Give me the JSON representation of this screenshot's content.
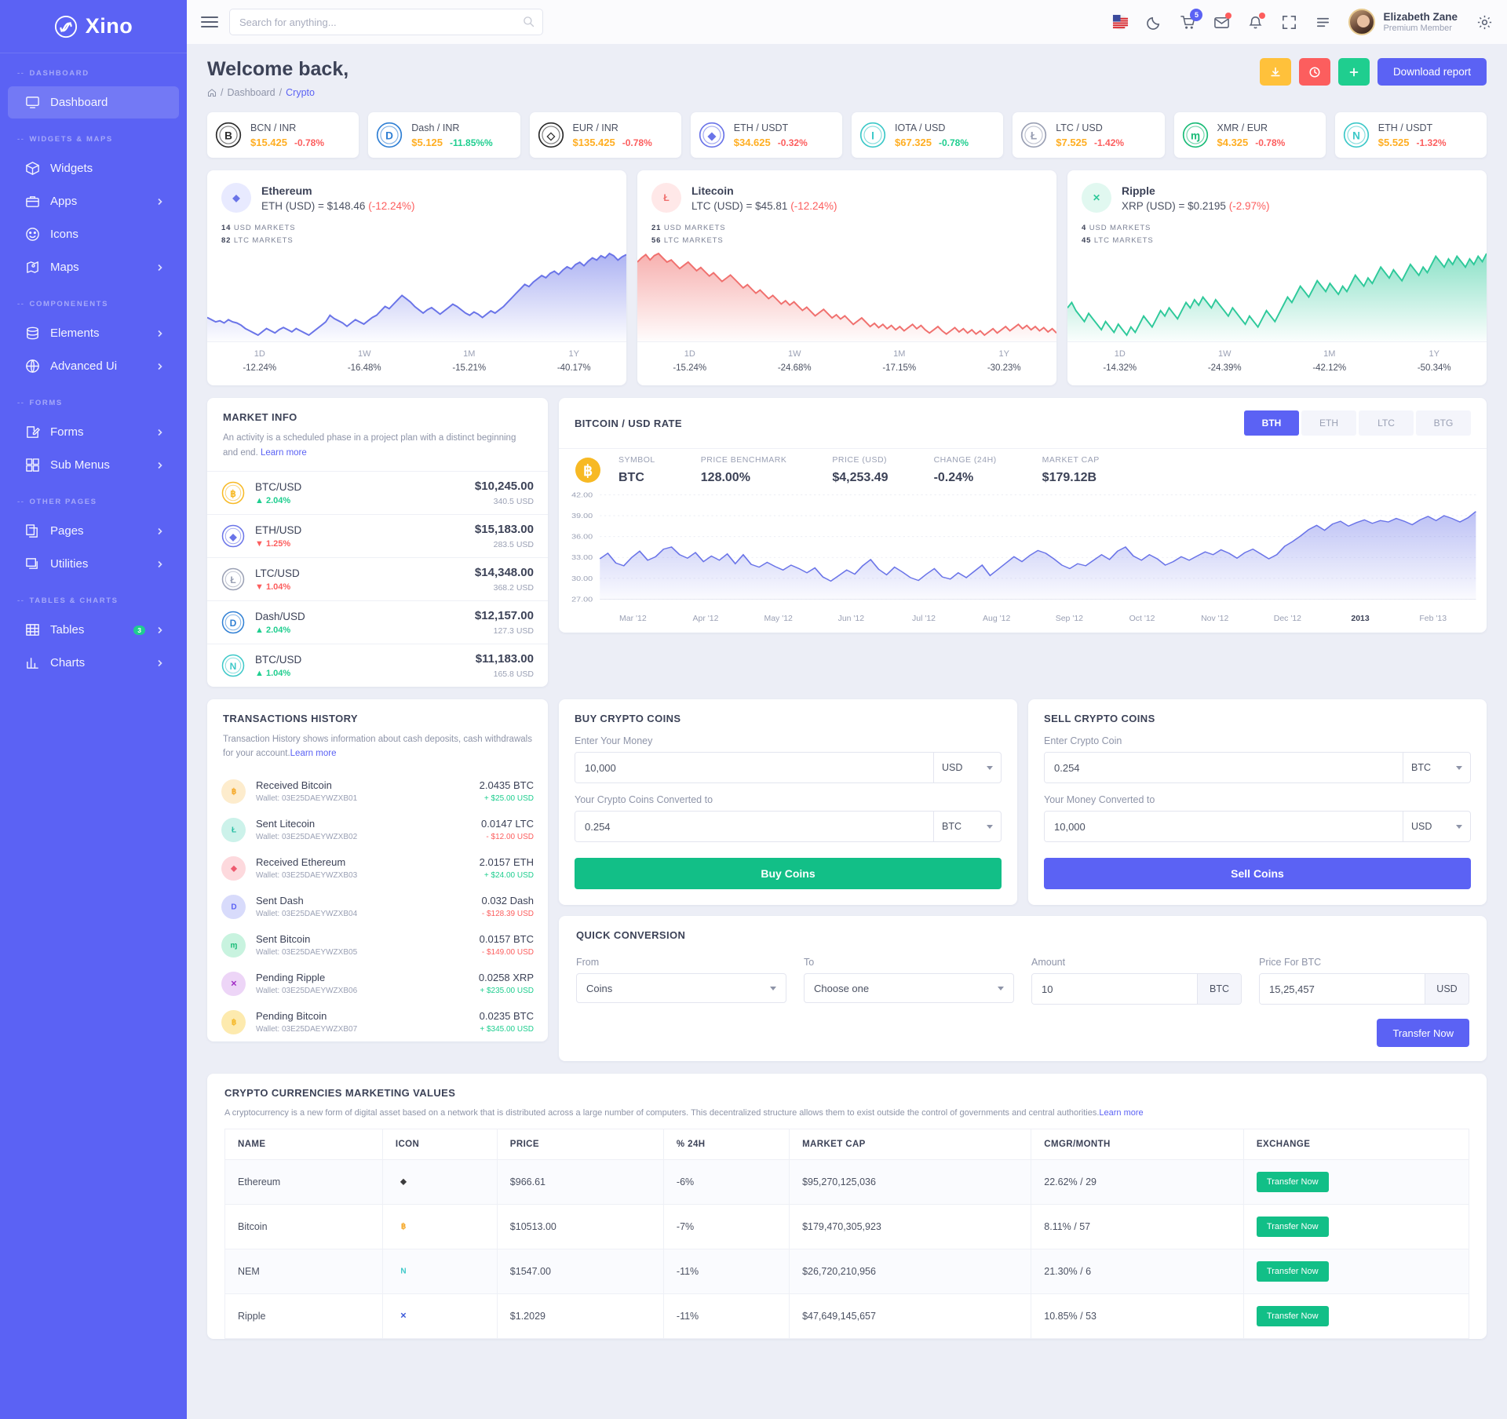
{
  "brand": {
    "name": "Xino",
    "logo_icon": "spiral-logo-icon"
  },
  "sidebar": {
    "sections": [
      {
        "label": "DASHBOARD",
        "items": [
          {
            "label": "Dashboard",
            "icon": "monitor-icon",
            "active": true,
            "chevron": false
          }
        ]
      },
      {
        "label": "WIDGETS & MAPS",
        "items": [
          {
            "label": "Widgets",
            "icon": "box-icon",
            "chevron": false
          },
          {
            "label": "Apps",
            "icon": "briefcase-icon",
            "chevron": true
          },
          {
            "label": "Icons",
            "icon": "smiley-icon",
            "chevron": false
          },
          {
            "label": "Maps",
            "icon": "map-pin-icon",
            "chevron": true
          }
        ]
      },
      {
        "label": "COMPONENENTS",
        "items": [
          {
            "label": "Elements",
            "icon": "database-icon",
            "chevron": true
          },
          {
            "label": "Advanced Ui",
            "icon": "globe-icon",
            "chevron": true
          }
        ]
      },
      {
        "label": "FORMS",
        "items": [
          {
            "label": "Forms",
            "icon": "edit-square-icon",
            "chevron": true
          },
          {
            "label": "Sub Menus",
            "icon": "grid-icon",
            "chevron": true
          }
        ]
      },
      {
        "label": "OTHER PAGES",
        "items": [
          {
            "label": "Pages",
            "icon": "copy-pages-icon",
            "chevron": true
          },
          {
            "label": "Utilities",
            "icon": "layers-icon",
            "chevron": true
          }
        ]
      },
      {
        "label": "TABLES & CHARTS",
        "items": [
          {
            "label": "Tables",
            "icon": "table-grid-icon",
            "chevron": true,
            "badge": "3"
          },
          {
            "label": "Charts",
            "icon": "bar-chart-icon",
            "chevron": true
          }
        ]
      }
    ]
  },
  "topbar": {
    "menu_icon": "hamburger-icon",
    "search_placeholder": "Search for anything...",
    "search_value": "",
    "icons": [
      {
        "name": "flag-us-icon"
      },
      {
        "name": "moon-icon"
      },
      {
        "name": "cart-icon",
        "badge": "5"
      },
      {
        "name": "mail-icon",
        "dot": true
      },
      {
        "name": "bell-icon",
        "dot": true
      },
      {
        "name": "fullscreen-icon"
      },
      {
        "name": "list-toggle-icon"
      }
    ],
    "user": {
      "name": "Elizabeth Zane",
      "role": "Premium Member"
    },
    "settings_icon": "gear-icon"
  },
  "header": {
    "title": "Welcome back,",
    "breadcrumb": {
      "home_icon": "home-icon",
      "sep": "/",
      "parent": "Dashboard",
      "current": "Crypto"
    },
    "buttons": {
      "download_icon": "download-icon",
      "clock_icon": "clock-icon",
      "plus_icon": "plus-icon",
      "report_label": "Download report"
    }
  },
  "tickers": [
    {
      "icon": "bytecoin-icon",
      "pair": "BCN / INR",
      "price": "$15.425",
      "change": "-0.78%",
      "dir": "down"
    },
    {
      "icon": "dash-icon",
      "pair": "Dash / INR",
      "price": "$5.125",
      "change": "-11.85%%",
      "dir": "up"
    },
    {
      "icon": "eos-icon",
      "pair": "EUR / INR",
      "price": "$135.425",
      "change": "-0.78%",
      "dir": "down"
    },
    {
      "icon": "ethereum-icon",
      "pair": "ETH / USDT",
      "price": "$34.625",
      "change": "-0.32%",
      "dir": "down"
    },
    {
      "icon": "iota-icon",
      "pair": "IOTA / USD",
      "price": "$67.325",
      "change": "-0.78%",
      "dir": "up"
    },
    {
      "icon": "litecoin-icon",
      "pair": "LTC / USD",
      "price": "$7.525",
      "change": "-1.42%",
      "dir": "down"
    },
    {
      "icon": "monero-icon",
      "pair": "XMR / EUR",
      "price": "$4.325",
      "change": "-0.78%",
      "dir": "down"
    },
    {
      "icon": "nem-icon",
      "pair": "ETH / USDT",
      "price": "$5.525",
      "change": "-1.32%",
      "dir": "down"
    }
  ],
  "coin_cards": [
    {
      "name": "Ethereum",
      "icon": "ethereum-icon",
      "accent": "#6a74e8",
      "badge_bg": "#e8eaff",
      "rate_prefix": "ETH (USD) = $148.46",
      "rate_change": "(-12.24%)",
      "markets": [
        {
          "n": "14",
          "t": "USD MARKETS"
        },
        {
          "n": "82",
          "t": "LTC MARKETS"
        }
      ],
      "periods": [
        {
          "k": "1D",
          "v": "-12.24%"
        },
        {
          "k": "1W",
          "v": "-16.48%"
        },
        {
          "k": "1M",
          "v": "-15.21%"
        },
        {
          "k": "1Y",
          "v": "-40.17%"
        }
      ],
      "chart_data": {
        "type": "area",
        "series_name": "Ethereum price",
        "values": [
          38,
          36,
          34,
          35,
          33,
          36,
          34,
          33,
          31,
          28,
          26,
          24,
          22,
          25,
          28,
          26,
          24,
          27,
          29,
          27,
          25,
          28,
          26,
          24,
          22,
          25,
          28,
          31,
          34,
          40,
          37,
          35,
          33,
          30,
          33,
          36,
          34,
          32,
          35,
          38,
          40,
          44,
          48,
          46,
          50,
          54,
          58,
          55,
          52,
          48,
          45,
          42,
          45,
          47,
          44,
          41,
          44,
          47,
          50,
          48,
          45,
          42,
          40,
          43,
          41,
          38,
          41,
          44,
          42,
          45,
          48,
          52,
          56,
          60,
          64,
          68,
          66,
          70,
          73,
          76,
          74,
          78,
          80,
          77,
          81,
          84,
          82,
          86,
          88,
          85,
          89,
          92,
          90,
          94,
          92,
          96,
          94,
          90,
          93,
          95
        ]
      }
    },
    {
      "name": "Litecoin",
      "icon": "litecoin-icon",
      "accent": "#f0706e",
      "badge_bg": "#ffe8e8",
      "rate_prefix": "LTC (USD) = $45.81",
      "rate_change": "(-12.24%)",
      "markets": [
        {
          "n": "21",
          "t": "USD MARKETS"
        },
        {
          "n": "56",
          "t": "LTC MARKETS"
        }
      ],
      "periods": [
        {
          "k": "1D",
          "v": "-15.24%"
        },
        {
          "k": "1W",
          "v": "-24.68%"
        },
        {
          "k": "1M",
          "v": "-17.15%"
        },
        {
          "k": "1Y",
          "v": "-30.23%"
        }
      ],
      "chart_data": {
        "type": "area",
        "series_name": "Litecoin price",
        "values": [
          88,
          92,
          95,
          90,
          94,
          96,
          92,
          88,
          90,
          86,
          82,
          85,
          88,
          84,
          80,
          83,
          79,
          75,
          78,
          74,
          70,
          73,
          76,
          72,
          68,
          64,
          67,
          63,
          59,
          62,
          58,
          54,
          57,
          53,
          49,
          52,
          48,
          51,
          47,
          43,
          46,
          42,
          38,
          41,
          44,
          40,
          36,
          39,
          35,
          38,
          34,
          30,
          33,
          36,
          32,
          28,
          31,
          27,
          30,
          26,
          29,
          25,
          28,
          24,
          27,
          30,
          26,
          29,
          25,
          22,
          25,
          28,
          24,
          21,
          24,
          27,
          23,
          26,
          22,
          25,
          21,
          24,
          20,
          23,
          26,
          22,
          25,
          28,
          24,
          27,
          30,
          26,
          29,
          25,
          28,
          24,
          27,
          23,
          26,
          22
        ]
      }
    },
    {
      "name": "Ripple",
      "icon": "ripple-icon",
      "accent": "#2ec99a",
      "badge_bg": "#e1f8f0",
      "rate_prefix": "XRP (USD) = $0.2195",
      "rate_change": "(-2.97%)",
      "markets": [
        {
          "n": "4",
          "t": "USD MARKETS"
        },
        {
          "n": "45",
          "t": "LTC MARKETS"
        }
      ],
      "periods": [
        {
          "k": "1D",
          "v": "-14.32%"
        },
        {
          "k": "1W",
          "v": "-24.39%"
        },
        {
          "k": "1M",
          "v": "-42.12%"
        },
        {
          "k": "1Y",
          "v": "-50.34%"
        }
      ],
      "chart_data": {
        "type": "area",
        "series_name": "Ripple price",
        "values": [
          54,
          58,
          52,
          48,
          44,
          50,
          46,
          42,
          38,
          44,
          40,
          36,
          42,
          38,
          34,
          40,
          36,
          42,
          48,
          44,
          40,
          46,
          52,
          48,
          54,
          50,
          46,
          52,
          58,
          54,
          60,
          56,
          62,
          58,
          54,
          60,
          56,
          52,
          48,
          54,
          50,
          46,
          42,
          48,
          44,
          40,
          46,
          52,
          48,
          44,
          50,
          56,
          62,
          58,
          64,
          70,
          66,
          62,
          68,
          74,
          70,
          66,
          72,
          68,
          64,
          70,
          66,
          72,
          78,
          74,
          70,
          76,
          72,
          78,
          84,
          80,
          76,
          82,
          78,
          74,
          80,
          86,
          82,
          78,
          84,
          80,
          86,
          92,
          88,
          84,
          90,
          86,
          92,
          88,
          84,
          90,
          86,
          92,
          88,
          94
        ]
      }
    }
  ],
  "market_info": {
    "title": "MARKET INFO",
    "desc": "An activity is a scheduled phase in a project plan with a distinct beginning and end.",
    "link": "Learn more",
    "rows": [
      {
        "icon": "bitcoin-icon",
        "pair": "BTC/USD",
        "change": "2.04%",
        "dir": "up",
        "price": "$10,245.00",
        "vol": "340.5 USD"
      },
      {
        "icon": "ethereum-icon",
        "pair": "ETH/USD",
        "change": "1.25%",
        "dir": "down",
        "price": "$15,183.00",
        "vol": "283.5 USD"
      },
      {
        "icon": "litecoin-icon",
        "pair": "LTC/USD",
        "change": "1.04%",
        "dir": "down",
        "price": "$14,348.00",
        "vol": "368.2 USD"
      },
      {
        "icon": "dash-icon",
        "pair": "Dash/USD",
        "change": "2.04%",
        "dir": "up",
        "price": "$12,157.00",
        "vol": "127.3 USD"
      },
      {
        "icon": "nem-icon",
        "pair": "BTC/USD",
        "change": "1.04%",
        "dir": "up",
        "price": "$11,183.00",
        "vol": "165.8 USD"
      }
    ]
  },
  "rate_panel": {
    "title": "BITCOIN / USD RATE",
    "tabs": [
      {
        "label": "BTH",
        "active": true
      },
      {
        "label": "ETH",
        "active": false
      },
      {
        "label": "LTC",
        "active": false
      },
      {
        "label": "BTG",
        "active": false
      }
    ],
    "coin_icon": "bitcoin-icon",
    "stats": [
      {
        "k": "SYMBOL",
        "v": "BTC"
      },
      {
        "k": "PRICE BENCHMARK",
        "v": "128.00%"
      },
      {
        "k": "PRICE (USD)",
        "v": "$4,253.49"
      },
      {
        "k": "CHANGE (24H)",
        "v": "-0.24%"
      },
      {
        "k": "MARKET CAP",
        "v": "$179.12B"
      }
    ],
    "chart_data": {
      "type": "area",
      "title": "BITCOIN / USD RATE",
      "ylabel": "",
      "xlabel": "",
      "ylim": [
        27.0,
        42.0
      ],
      "yticks": [
        "27.00",
        "30.00",
        "33.00",
        "36.00",
        "39.00",
        "42.00"
      ],
      "grid": true,
      "x": [
        "Mar '12",
        "Apr '12",
        "May '12",
        "Jun '12",
        "Jul '12",
        "Aug '12",
        "Sep '12",
        "Oct '12",
        "Nov '12",
        "Dec '12",
        "2013",
        "Feb '13"
      ],
      "x_bold": "2013",
      "series": [
        {
          "name": "BTC/USD",
          "values": [
            32.8,
            33.6,
            32.2,
            31.8,
            33.0,
            33.9,
            32.6,
            33.1,
            34.2,
            34.5,
            33.4,
            32.9,
            33.7,
            32.4,
            33.2,
            32.6,
            33.5,
            32.1,
            33.4,
            32.0,
            31.6,
            32.3,
            31.7,
            31.2,
            31.9,
            31.4,
            30.8,
            31.5,
            30.2,
            29.6,
            30.4,
            31.2,
            30.6,
            31.8,
            32.7,
            31.3,
            30.5,
            31.6,
            30.9,
            30.1,
            29.7,
            30.6,
            31.4,
            30.2,
            29.9,
            30.8,
            30.1,
            31.0,
            31.9,
            30.4,
            31.3,
            32.2,
            33.1,
            32.4,
            33.3,
            34.0,
            33.6,
            32.8,
            31.9,
            31.4,
            32.1,
            31.8,
            32.6,
            33.4,
            32.7,
            33.9,
            34.5,
            33.2,
            32.6,
            33.4,
            32.8,
            31.9,
            32.4,
            33.1,
            32.6,
            33.2,
            33.8,
            33.4,
            34.1,
            33.6,
            32.9,
            33.7,
            34.2,
            33.5,
            32.8,
            33.4,
            34.6,
            35.3,
            36.1,
            37.0,
            37.6,
            36.9,
            37.8,
            38.2,
            37.5,
            38.0,
            38.4,
            37.9,
            38.3,
            38.1,
            38.6,
            38.2,
            37.7,
            38.4,
            38.9,
            38.3,
            39.0,
            38.6,
            38.1,
            38.7,
            39.6
          ]
        }
      ]
    }
  },
  "transactions": {
    "title": "TRANSACTIONS HISTORY",
    "desc": "Transaction History shows information about cash deposits, cash withdrawals for your account.",
    "link": "Learn more",
    "rows": [
      {
        "icon": "bitcoin-icon",
        "bg": "#fdeccd",
        "fg": "#f5a623",
        "title": "Received Bitcoin",
        "wallet": "Wallet: 03E25DAEYWZXB01",
        "amount": "2.0435 BTC",
        "usd": "+ $25.00 USD",
        "dir": "up"
      },
      {
        "icon": "litecoin-icon",
        "bg": "#ccf2ea",
        "fg": "#2bbfa5",
        "title": "Sent Litecoin",
        "wallet": "Wallet: 03E25DAEYWZXB02",
        "amount": "0.0147 LTC",
        "usd": "- $12.00 USD",
        "dir": "down"
      },
      {
        "icon": "ethereum-icon",
        "bg": "#fdd9dd",
        "fg": "#ee5a6f",
        "title": "Received Ethereum",
        "wallet": "Wallet: 03E25DAEYWZXB03",
        "amount": "2.0157 ETH",
        "usd": "+ $24.00 USD",
        "dir": "up"
      },
      {
        "icon": "dash-icon",
        "bg": "#d8dbfb",
        "fg": "#5b62f4",
        "title": "Sent Dash",
        "wallet": "Wallet: 03E25DAEYWZXB04",
        "amount": "0.032 Dash",
        "usd": "- $128.39 USD",
        "dir": "down"
      },
      {
        "icon": "monero-icon",
        "bg": "#c8f3df",
        "fg": "#19bb77",
        "title": "Sent Bitcoin",
        "wallet": "Wallet: 03E25DAEYWZXB05",
        "amount": "0.0157 BTC",
        "usd": "- $149.00 USD",
        "dir": "down"
      },
      {
        "icon": "ripple-icon",
        "bg": "#edd5f7",
        "fg": "#a02bc5",
        "title": "Pending Ripple",
        "wallet": "Wallet: 03E25DAEYWZXB06",
        "amount": "0.0258 XRP",
        "usd": "+ $235.00 USD",
        "dir": "up"
      },
      {
        "icon": "bitcoin-icon",
        "bg": "#fdeaae",
        "fg": "#f5b623",
        "title": "Pending Bitcoin",
        "wallet": "Wallet: 03E25DAEYWZXB07",
        "amount": "0.0235 BTC",
        "usd": "+ $345.00 USD",
        "dir": "up"
      }
    ]
  },
  "buy_panel": {
    "title": "BUY CRYPTO COINS",
    "label1": "Enter Your Money",
    "value1": "10,000",
    "unit1": "USD",
    "label2": "Your Crypto Coins Converted to",
    "value2": "0.254",
    "unit2": "BTC",
    "button": "Buy Coins"
  },
  "sell_panel": {
    "title": "SELL CRYPTO COINS",
    "label1": "Enter Crypto Coin",
    "value1": "0.254",
    "unit1": "BTC",
    "label2": "Your Money Converted to",
    "value2": "10,000",
    "unit2": "USD",
    "button": "Sell Coins"
  },
  "quick_conversion": {
    "title": "QUICK CONVERSION",
    "from_label": "From",
    "from_value": "Coins",
    "to_label": "To",
    "to_value": "Choose one",
    "amount_label": "Amount",
    "amount_value": "10",
    "amount_unit": "BTC",
    "price_label": "Price For BTC",
    "price_value": "15,25,457",
    "price_unit": "USD",
    "button": "Transfer Now"
  },
  "marketing_table": {
    "title": "CRYPTO CURRENCIES MARKETING VALUES",
    "desc": "A cryptocurrency is a new form of digital asset based on a network that is distributed across a large number of computers. This decentralized structure allows them to exist outside the control of governments and central authorities.",
    "link": "Learn more",
    "columns": [
      "NAME",
      "ICON",
      "PRICE",
      "% 24H",
      "MARKET CAP",
      "CMGR/MONTH",
      "EXCHANGE"
    ],
    "rows": [
      {
        "name": "Ethereum",
        "icon": "ethereum-icon",
        "icon_color": "#3c3c3d",
        "price": "$966.61",
        "change": "-6%",
        "market_cap": "$95,270,125,036",
        "cmgr": "22.62% / 29",
        "action": "Transfer Now"
      },
      {
        "name": "Bitcoin",
        "icon": "bitcoin-icon",
        "icon_color": "#f5a623",
        "price": "$10513.00",
        "change": "-7%",
        "market_cap": "$179,470,305,923",
        "cmgr": "8.11% / 57",
        "action": "Transfer Now"
      },
      {
        "name": "NEM",
        "icon": "nem-icon",
        "icon_color": "#3cc8c8",
        "price": "$1547.00",
        "change": "-11%",
        "market_cap": "$26,720,210,956",
        "cmgr": "21.30% / 6",
        "action": "Transfer Now"
      },
      {
        "name": "Ripple",
        "icon": "ripple-icon",
        "icon_color": "#3b59d9",
        "price": "$1.2029",
        "change": "-11%",
        "market_cap": "$47,649,145,657",
        "cmgr": "10.85% / 53",
        "action": "Transfer Now"
      }
    ]
  }
}
